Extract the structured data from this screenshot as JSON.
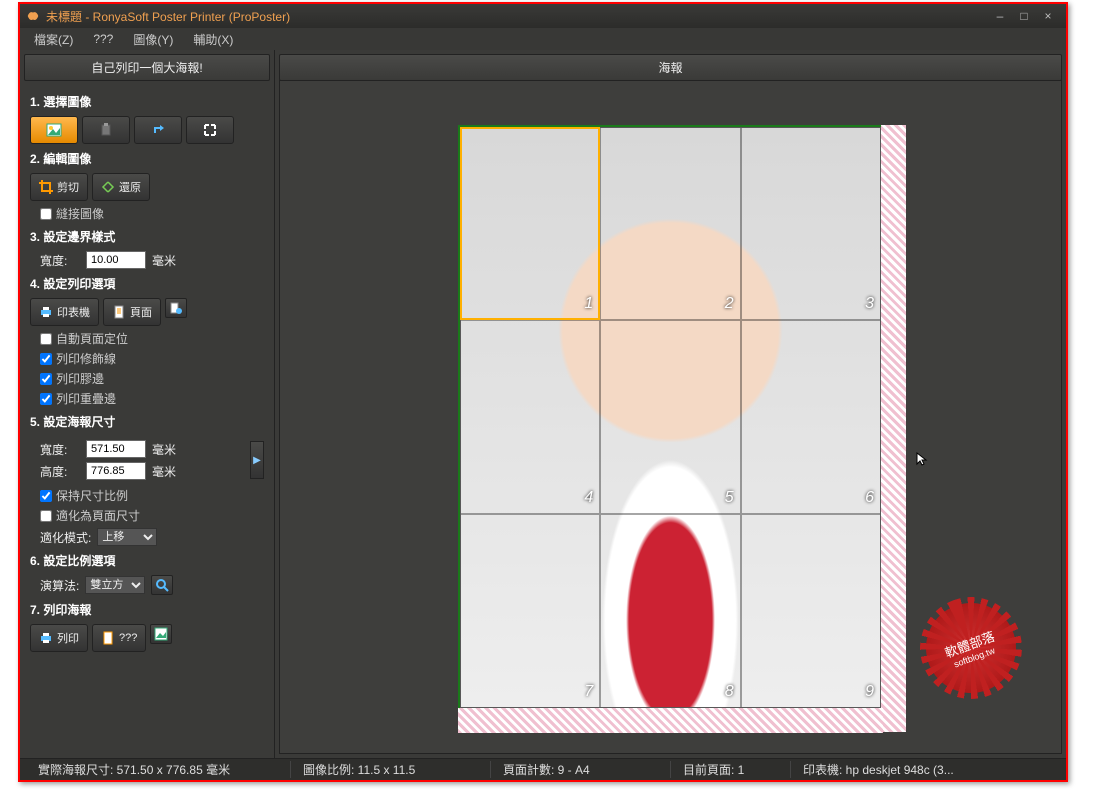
{
  "window": {
    "title": "未標題 - RonyaSoft Poster Printer (ProPoster)",
    "minimize": "–",
    "maximize": "□",
    "close": "×"
  },
  "menu": {
    "file": "檔案(Z)",
    "question": "???",
    "image": "圖像(Y)",
    "help": "輔助(X)"
  },
  "sidebar": {
    "header": "自己列印一個大海報!",
    "step1": {
      "title": "1. 選擇圖像"
    },
    "step2": {
      "title": "2. 編輯圖像",
      "crop": "剪切",
      "restore": "還原",
      "stitch": "縫接圖像"
    },
    "step3": {
      "title": "3. 設定邊界樣式",
      "width_label": "寬度:",
      "width_value": "10.00",
      "unit": "毫米"
    },
    "step4": {
      "title": "4. 設定列印選項",
      "printer": "印表機",
      "page": "頁面",
      "auto_orient": "自動頁面定位",
      "print_trim": "列印修飾線",
      "print_glue": "列印膠邊",
      "print_overlap": "列印重疊邊"
    },
    "step5": {
      "title": "5. 設定海報尺寸",
      "width_label": "寬度:",
      "width_value": "571.50",
      "height_label": "高度:",
      "height_value": "776.85",
      "unit": "毫米",
      "keep_ratio": "保持尺寸比例",
      "fit_page": "適化為頁面尺寸",
      "fitmode_label": "適化模式:",
      "fitmode_value": "上移"
    },
    "step6": {
      "title": "6. 設定比例選項",
      "algo_label": "演算法:",
      "algo_value": "雙立方"
    },
    "step7": {
      "title": "7. 列印海報",
      "print": "列印",
      "question": "???"
    }
  },
  "main": {
    "header": "海報"
  },
  "poster": {
    "cells": [
      "1",
      "2",
      "3",
      "4",
      "5",
      "6",
      "7",
      "8",
      "9"
    ]
  },
  "badge": {
    "line1": "軟體部落",
    "line2": "softblog.tw"
  },
  "status": {
    "size": "實際海報尺寸: 571.50 x 776.85 毫米",
    "ratio": "圖像比例: 11.5 x 11.5",
    "pages": "頁面計數: 9 - A4",
    "current": "目前頁面: 1",
    "printer": "印表機: hp deskjet 948c (3..."
  }
}
